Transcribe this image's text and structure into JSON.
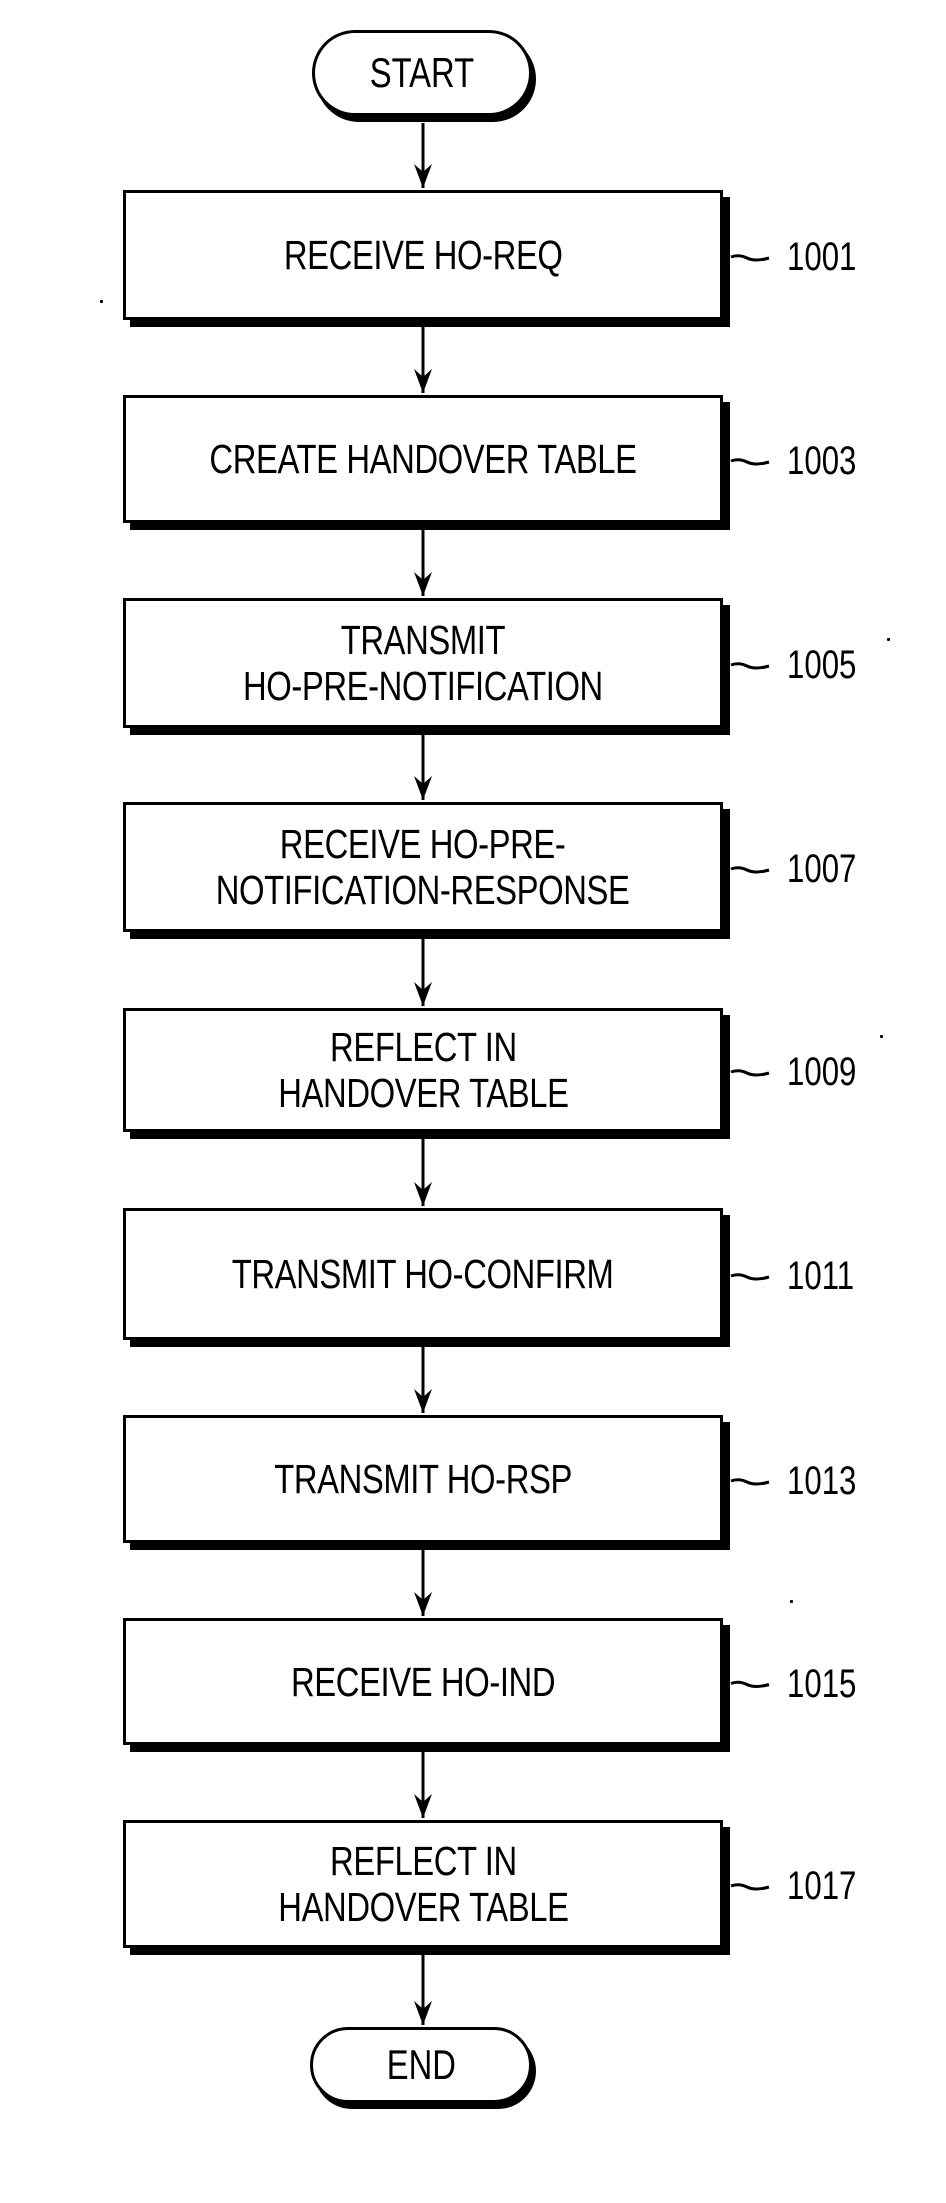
{
  "figure": {
    "type": "flowchart",
    "start": {
      "label": "START"
    },
    "end": {
      "label": "END"
    },
    "steps": [
      {
        "ref": "1001",
        "text": "RECEIVE HO-REQ"
      },
      {
        "ref": "1003",
        "text": "CREATE HANDOVER TABLE"
      },
      {
        "ref": "1005",
        "text": "TRANSMIT\nHO-PRE-NOTIFICATION"
      },
      {
        "ref": "1007",
        "text": "RECEIVE HO-PRE-\nNOTIFICATION-RESPONSE"
      },
      {
        "ref": "1009",
        "text": "REFLECT IN\nHANDOVER TABLE"
      },
      {
        "ref": "1011",
        "text": "TRANSMIT HO-CONFIRM"
      },
      {
        "ref": "1013",
        "text": "TRANSMIT HO-RSP"
      },
      {
        "ref": "1015",
        "text": "RECEIVE HO-IND"
      },
      {
        "ref": "1017",
        "text": "REFLECT IN\nHANDOVER TABLE"
      }
    ],
    "colors": {
      "ink": "#000000",
      "paper": "#ffffff"
    }
  }
}
